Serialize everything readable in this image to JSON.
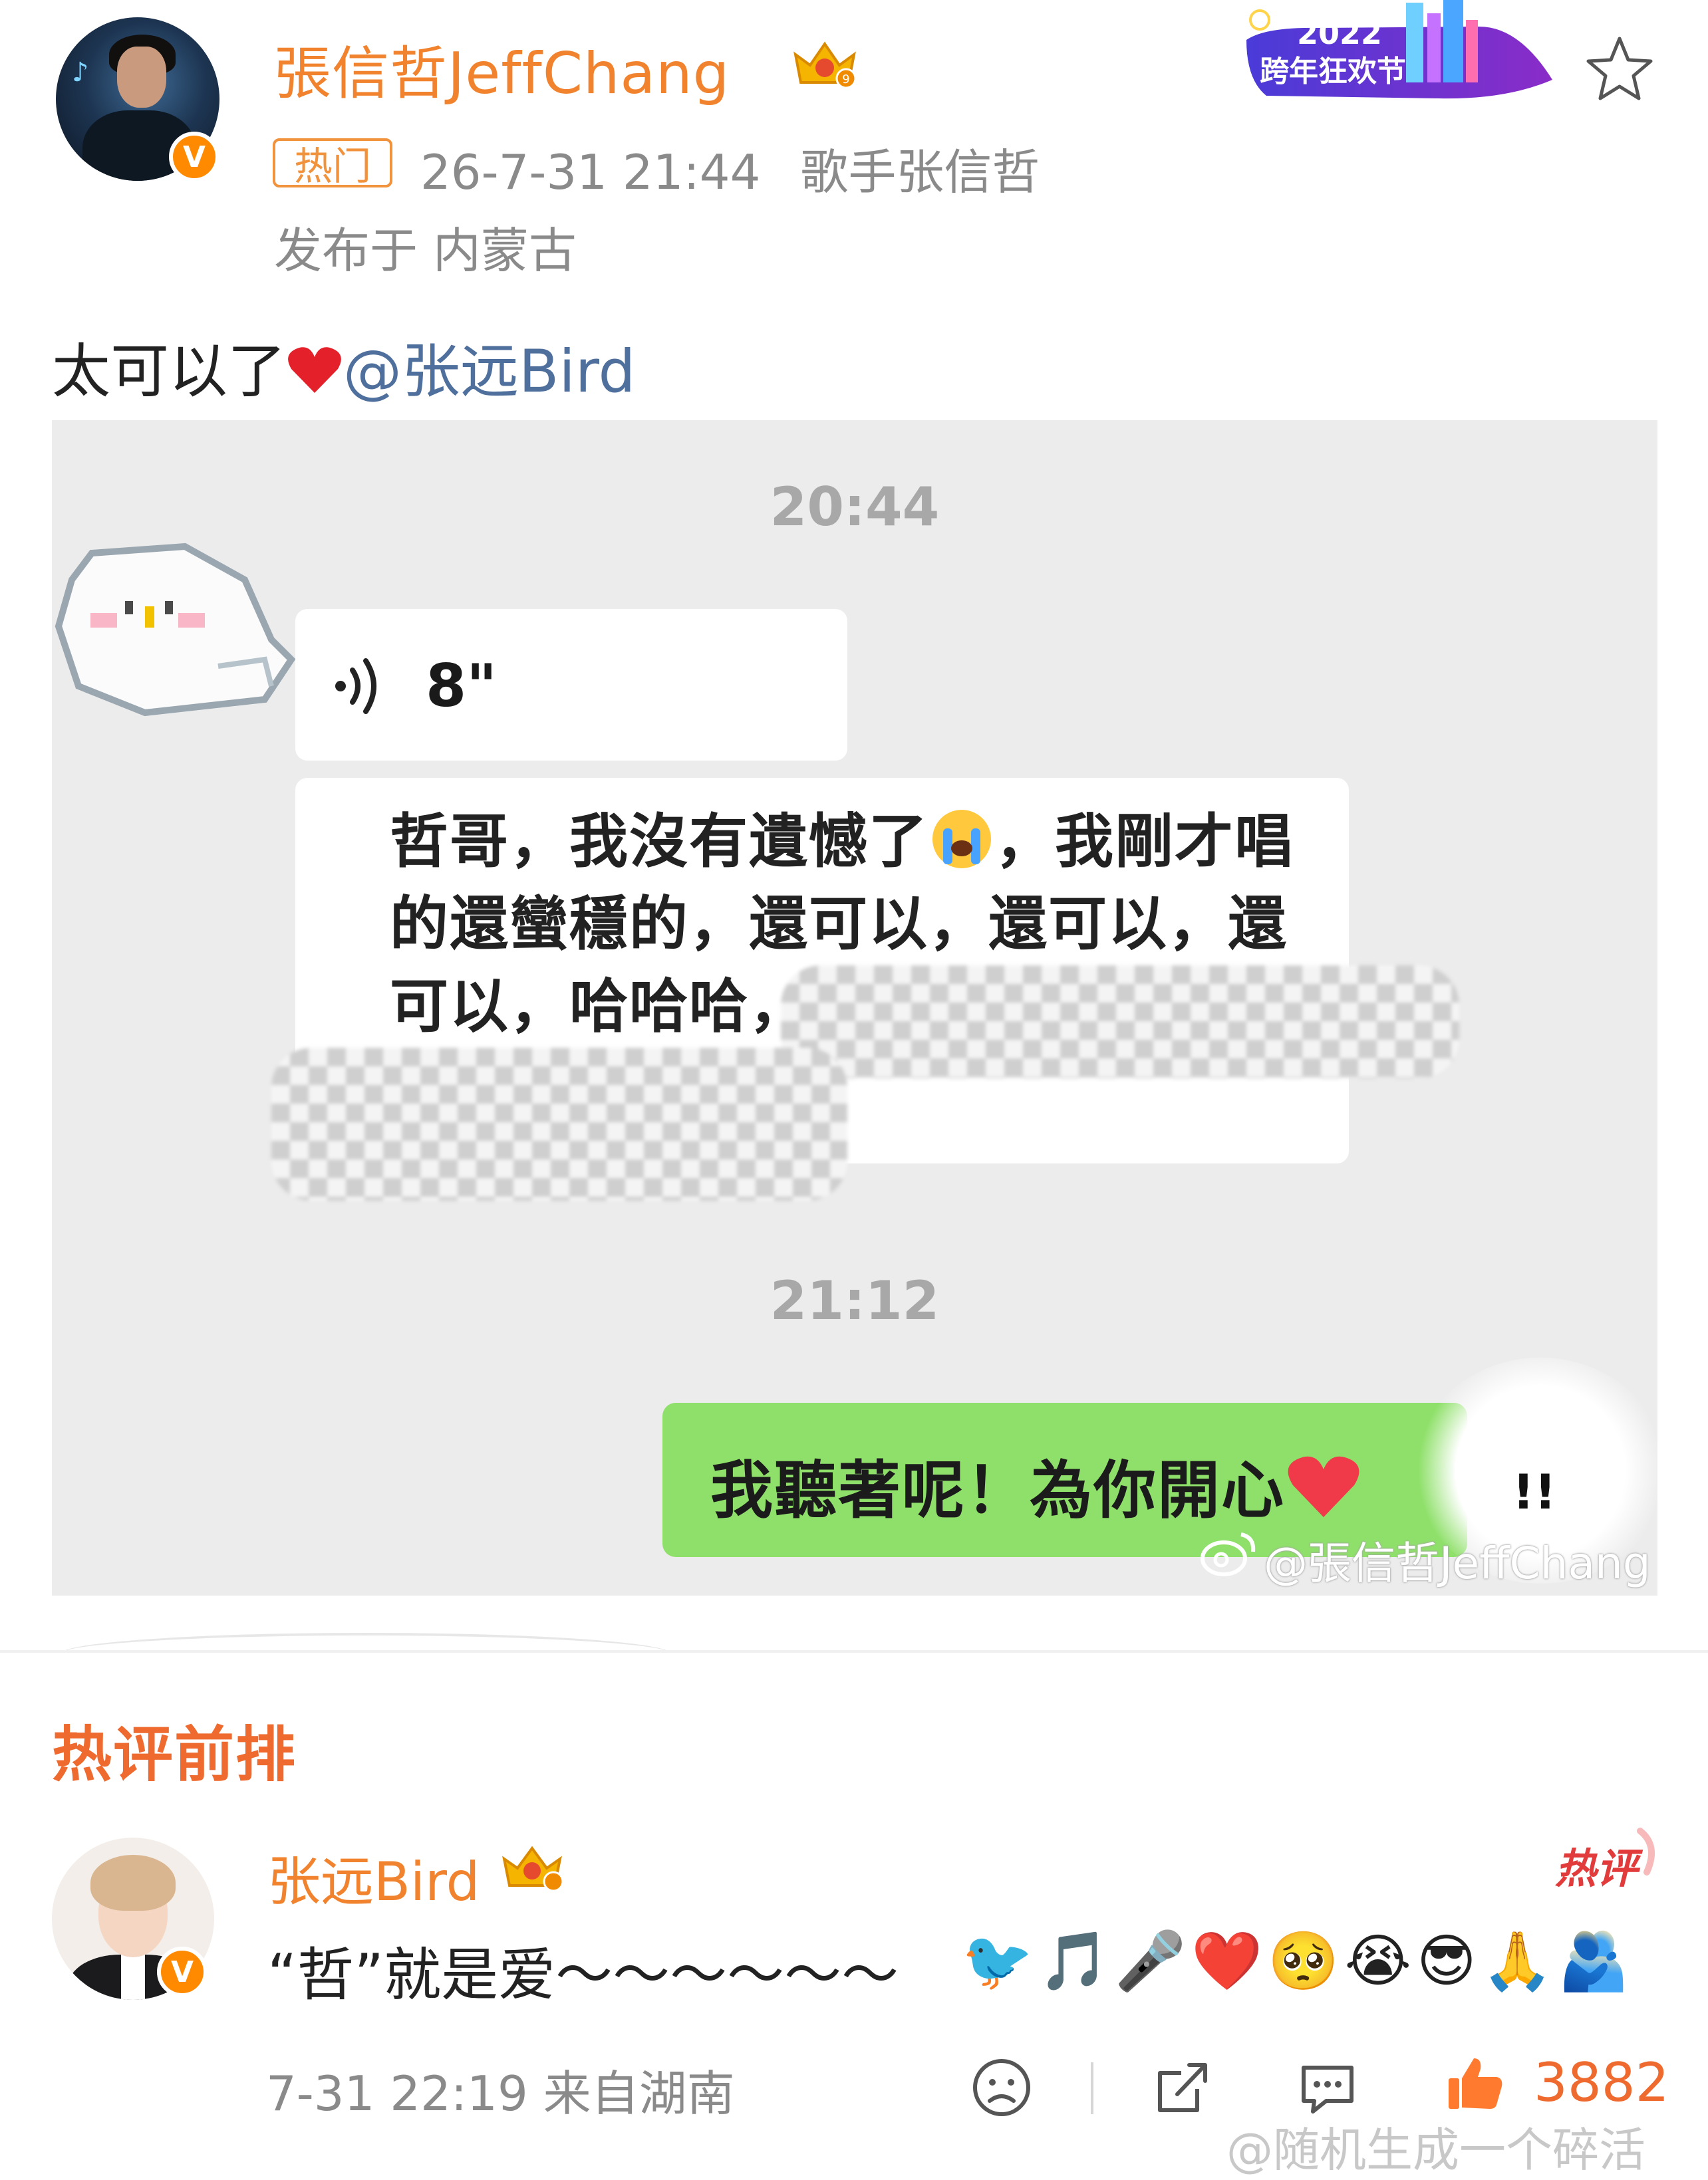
{
  "post": {
    "username": "張信哲JeffChang",
    "hot_tag": "热门",
    "timestamp": "26-7-31 21:44",
    "source": "歌手张信哲",
    "location": "发布于 内蒙古",
    "text_prefix": "太可以了",
    "mention": "@张远Bird",
    "banner_year": "2022",
    "banner_text": "跨年狂欢节",
    "colors": {
      "username": "#f2832e",
      "mention": "#4f6f9d",
      "meta": "#8a8a8a"
    }
  },
  "chat_image": {
    "time_1": "20:44",
    "voice_length": "8\"",
    "message_text": "哲哥，我沒有遺憾了😭，我剛才唱的還蠻穩的，還可以，還可以，還可以，哈哈哈，",
    "message_line_1_a": "哲哥，我沒有遺憾了",
    "message_line_1_b": "，我剛才唱",
    "message_line_2": "的還蠻穩的，還可以，還可以，還",
    "message_line_3": "可以，哈哈哈，",
    "time_2": "21:12",
    "reply_text": "我聽著呢！為你開心",
    "exclaim": "!!",
    "watermark": "@張信哲JeffChang",
    "colors": {
      "background": "#ececec",
      "reply_bubble": "#8fe06a"
    }
  },
  "comments": {
    "section_title": "热评前排",
    "hot_comment_badge": "热评",
    "items": [
      {
        "username": "张远Bird",
        "text": "“哲”就是爱～～～～～～",
        "emojis": [
          "🐦",
          "🎵",
          "🎤",
          "❤️",
          "🥺",
          "😭",
          "😎",
          "🙏",
          "🫂"
        ],
        "time": "7-31 22:19  来自湖南",
        "likes": "3882"
      }
    ]
  },
  "footer_watermark": "@随机生成一个碎活"
}
